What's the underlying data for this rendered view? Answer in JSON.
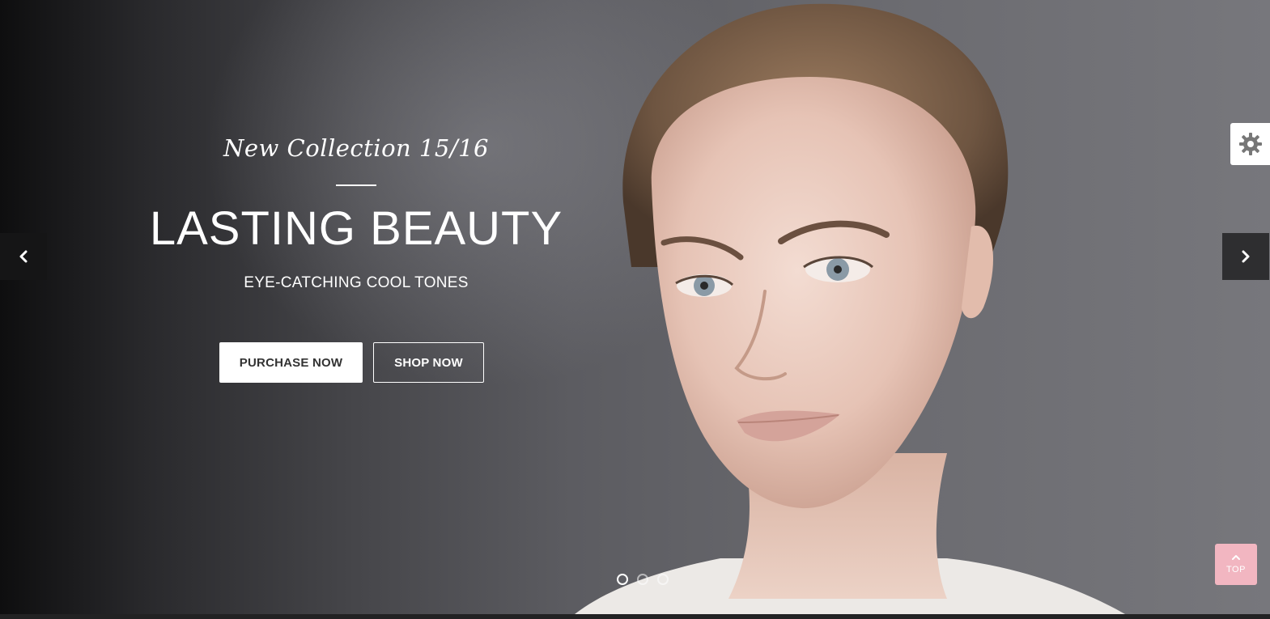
{
  "slider": {
    "subtitle": "New Collection 15/16",
    "headline": "LASTING BEAUTY",
    "tagline": "EYE-CATCHING COOL TONES",
    "buttons": {
      "purchase_label": "PURCHASE NOW",
      "shop_label": "SHOP NOW"
    },
    "prev_icon": "chevron-left-icon",
    "next_icon": "chevron-right-icon",
    "pagination": {
      "total": 3,
      "active_index": 0
    }
  },
  "settings": {
    "icon": "gear-icon"
  },
  "scroll_top": {
    "label": "TOP",
    "icon": "chevron-up-icon"
  },
  "colors": {
    "accent_pink": "#f2b6c1",
    "button_text": "#333333",
    "arrow_bg": "#151516"
  }
}
